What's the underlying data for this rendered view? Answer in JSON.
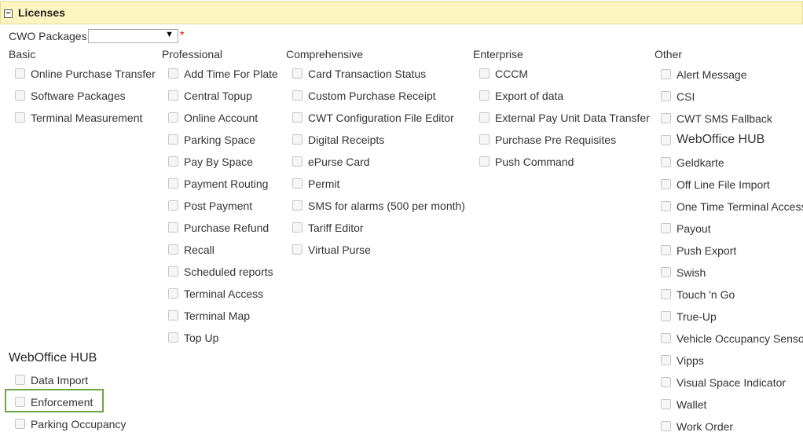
{
  "header": {
    "title": "Licenses",
    "collapse_glyph": "−"
  },
  "packages": {
    "label": "CWO Packages",
    "selected": "",
    "arrow": "▼",
    "required_mark": "*"
  },
  "columns": {
    "basic": {
      "title": "Basic",
      "items": [
        "Online Purchase Transfer",
        "Software Packages",
        "Terminal Measurement"
      ]
    },
    "professional": {
      "title": "Professional",
      "items": [
        "Add Time For Plate",
        "Central Topup",
        "Online Account",
        "Parking Space",
        "Pay By Space",
        "Payment Routing",
        "Post Payment",
        "Purchase Refund",
        "Recall",
        "Scheduled reports",
        "Terminal Access",
        "Terminal Map",
        "Top Up"
      ]
    },
    "comprehensive": {
      "title": "Comprehensive",
      "items": [
        "Card Transaction Status",
        "Custom Purchase Receipt",
        "CWT Configuration File Editor",
        "Digital Receipts",
        "ePurse Card",
        "Permit",
        "SMS for alarms (500 per month)",
        "Tariff Editor",
        "Virtual Purse"
      ]
    },
    "enterprise": {
      "title": "Enterprise",
      "items": [
        "CCCM",
        "Export of data",
        "External Pay Unit Data Transfer",
        "Purchase Pre Requisites",
        "Push Command"
      ]
    },
    "other": {
      "title": "Other",
      "items": [
        "Alert Message",
        "CSI",
        "CWT SMS Fallback",
        "WebOffice HUB",
        "Geldkarte",
        "Off Line File Import",
        "One Time Terminal Access",
        "Payout",
        "Push Export",
        "Swish",
        "Touch 'n Go",
        "True-Up",
        "Vehicle Occupancy Sensor",
        "Vipps",
        "Visual Space Indicator",
        "Wallet",
        "Work Order"
      ]
    }
  },
  "hub": {
    "title": "WebOffice HUB",
    "items": [
      "Data Import",
      "Enforcement",
      "Parking Occupancy"
    ]
  }
}
